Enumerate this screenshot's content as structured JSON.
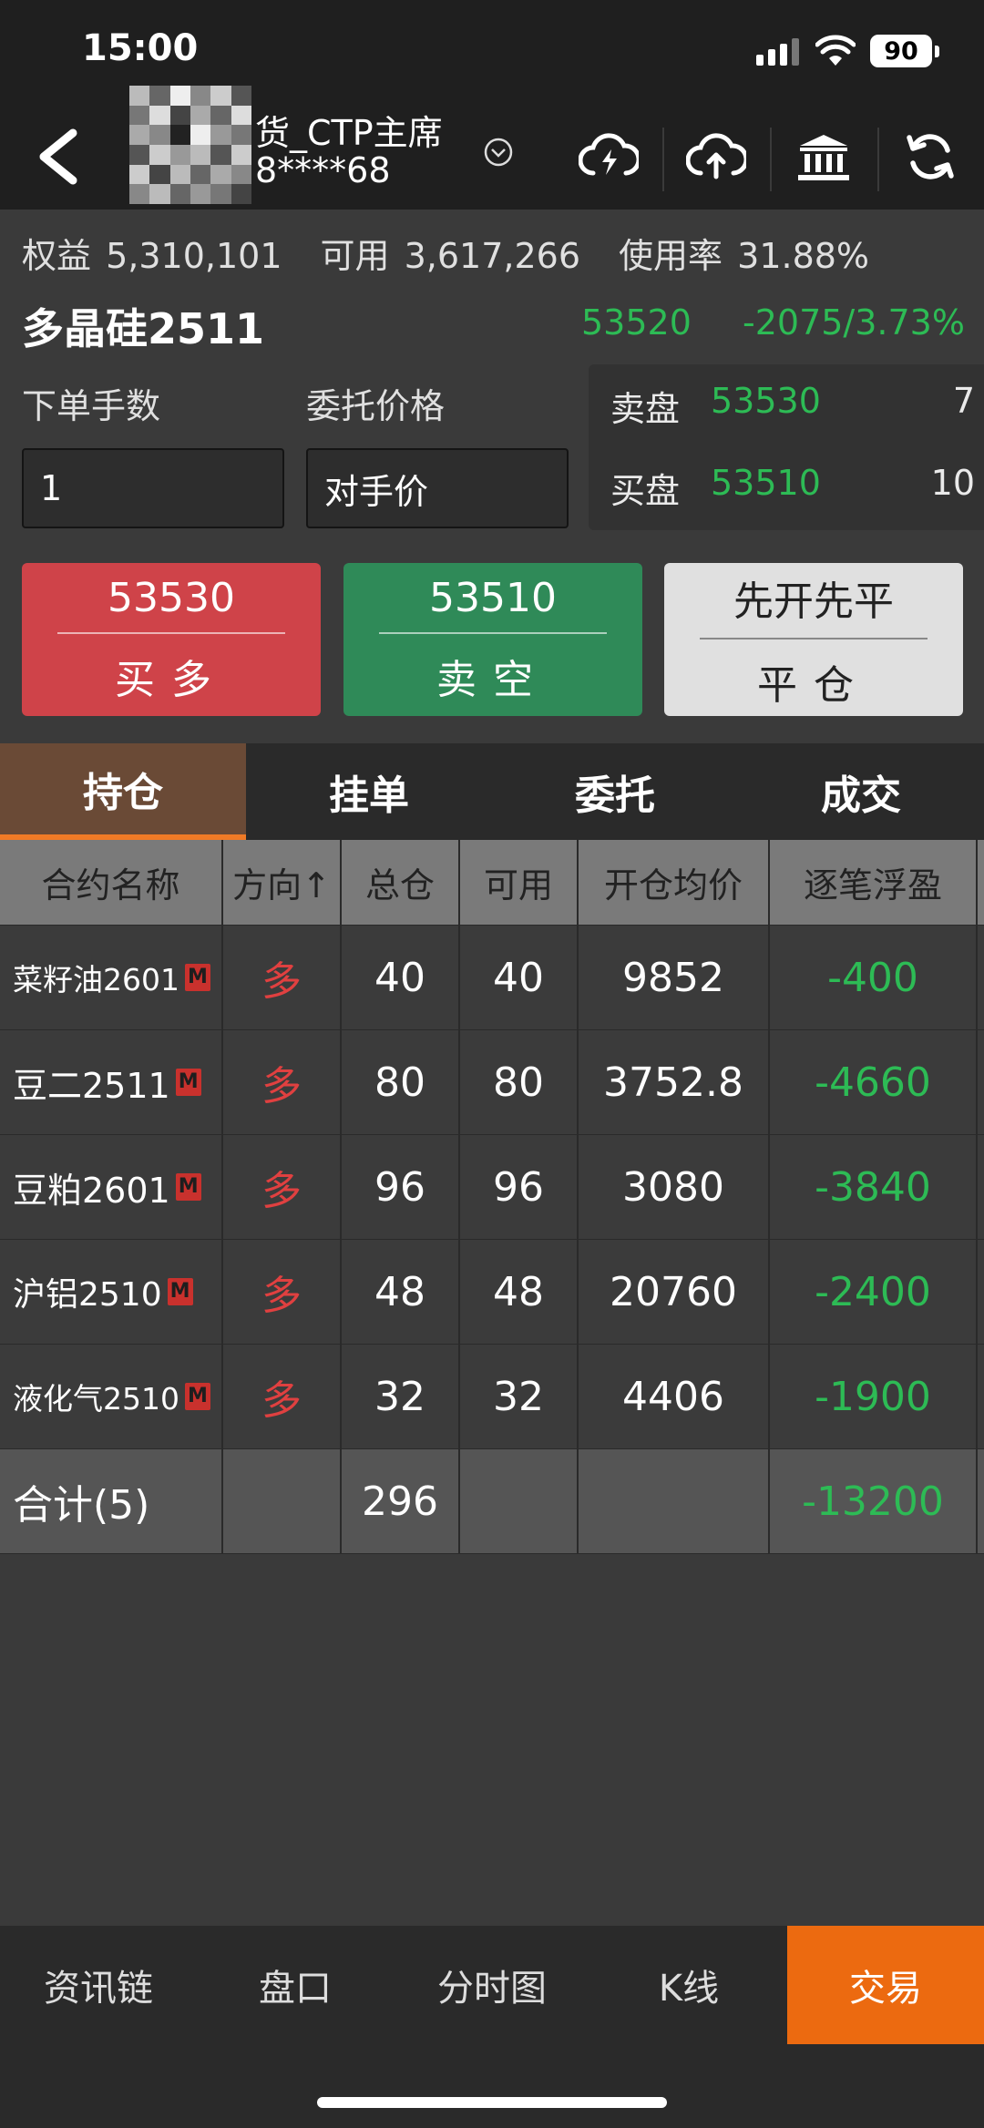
{
  "status_bar": {
    "time": "15:00",
    "battery": "90"
  },
  "nav": {
    "account_name": "货_CTP主席",
    "account_id": "8****68",
    "icons": [
      "back-icon",
      "cloud-lightning-icon",
      "cloud-upload-icon",
      "bank-icon",
      "refresh-icon"
    ]
  },
  "account": {
    "equity_label": "权益",
    "equity": "5,310,101",
    "available_label": "可用",
    "available": "3,617,266",
    "usage_label": "使用率",
    "usage": "31.88%"
  },
  "product": {
    "name": "多晶硅2511",
    "last_price": "53520",
    "change": "-2075/3.73%"
  },
  "order": {
    "qty_label": "下单手数",
    "qty_value": "1",
    "price_label": "委托价格",
    "price_value": "对手价"
  },
  "book": {
    "ask_label": "卖盘",
    "ask_price": "53530",
    "ask_vol": "7",
    "bid_label": "买盘",
    "bid_price": "53510",
    "bid_vol": "10"
  },
  "buttons": {
    "buy_price": "53530",
    "buy_label": "买多",
    "sell_price": "53510",
    "sell_label": "卖空",
    "close_mode": "先开先平",
    "close_label": "平仓"
  },
  "tabs": [
    "持仓",
    "挂单",
    "委托",
    "成交"
  ],
  "positions": {
    "headers": [
      "合约名称",
      "方向↑",
      "总仓",
      "可用",
      "开仓均价",
      "逐笔浮盈"
    ],
    "rows": [
      {
        "name": "菜籽油2601",
        "badge": "M",
        "dir": "多",
        "total": "40",
        "avail": "40",
        "avg": "9852",
        "pnl": "-400"
      },
      {
        "name": "豆二2511",
        "badge": "M",
        "dir": "多",
        "total": "80",
        "avail": "80",
        "avg": "3752.8",
        "pnl": "-4660"
      },
      {
        "name": "豆粕2601",
        "badge": "M",
        "dir": "多",
        "total": "96",
        "avail": "96",
        "avg": "3080",
        "pnl": "-3840"
      },
      {
        "name": "沪铝2510",
        "badge": "M",
        "dir": "多",
        "total": "48",
        "avail": "48",
        "avg": "20760",
        "pnl": "-2400"
      },
      {
        "name": "液化气2510",
        "badge": "M",
        "dir": "多",
        "total": "32",
        "avail": "32",
        "avg": "4406",
        "pnl": "-1900"
      }
    ],
    "total": {
      "label": "合计(5)",
      "total": "296",
      "pnl": "-13200"
    }
  },
  "bottom_nav": [
    "资讯链",
    "盘口",
    "分时图",
    "K线",
    "交易"
  ]
}
